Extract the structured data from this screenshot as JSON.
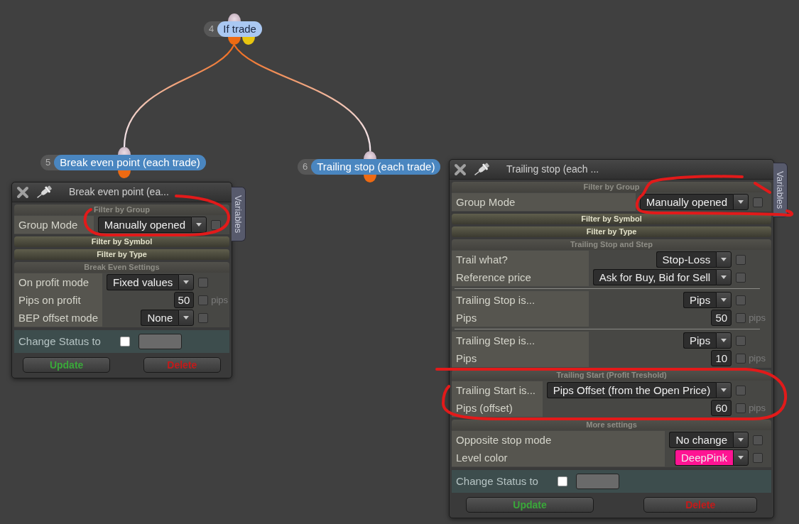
{
  "nodes": [
    {
      "number": "4",
      "title": "If trade",
      "color": "#aac8f2",
      "outputs": [
        {
          "color": "#ee6a12"
        },
        {
          "color": "#e8c510"
        }
      ],
      "children": [
        {
          "number": "5",
          "title": "Break even point (each trade)",
          "color": "#4a86c0",
          "outputs": [
            {
              "color": "#ee6a12"
            }
          ]
        },
        {
          "number": "6",
          "title": "Trailing stop (each trade)",
          "color": "#4a86c0",
          "outputs": [
            {
              "color": "#ee6a12"
            }
          ]
        }
      ]
    }
  ],
  "panels": [
    {
      "title": "Break even point (ea...",
      "side_tab": "Variables",
      "sections": [
        {
          "title": "Filter by Group",
          "expanded": true,
          "groups": [
            [
              {
                "kind": "select",
                "label": "Group Mode",
                "value": "Manually opened",
                "checked": false
              }
            ]
          ]
        },
        {
          "title": "Filter by Symbol",
          "expanded": false
        },
        {
          "title": "Filter by Type",
          "expanded": false
        },
        {
          "title": "Break Even Settings",
          "expanded": true,
          "groups": [
            [
              {
                "kind": "select",
                "label": "On profit mode",
                "value": "Fixed values",
                "checked": false
              },
              {
                "kind": "number",
                "label": "Pips on profit",
                "value": "50",
                "checked": false,
                "unit": "pips"
              },
              {
                "kind": "select",
                "label": "BEP offset mode",
                "value": "None",
                "checked": false
              }
            ]
          ]
        }
      ],
      "status": {
        "label": "Change Status to",
        "checked": false
      },
      "buttons": [
        {
          "label": "Update",
          "kind": "update"
        },
        {
          "label": "Delete",
          "kind": "delete"
        }
      ]
    },
    {
      "title": "Trailing stop (each ...",
      "side_tab": "Variables",
      "sections": [
        {
          "title": "Filter by Group",
          "expanded": true,
          "groups": [
            [
              {
                "kind": "select",
                "label": "Group Mode",
                "value": "Manually opened",
                "checked": false
              }
            ]
          ]
        },
        {
          "title": "Filter by Symbol",
          "expanded": false
        },
        {
          "title": "Filter by Type",
          "expanded": false
        },
        {
          "title": "Trailing Stop and Step",
          "expanded": true,
          "groups": [
            [
              {
                "kind": "select",
                "label": "Trail what?",
                "value": "Stop-Loss",
                "checked": false
              },
              {
                "kind": "select",
                "label": "Reference price",
                "value": "Ask for Buy, Bid for Sell",
                "checked": false
              }
            ],
            [
              {
                "kind": "select",
                "label": "Trailing Stop is...",
                "value": "Pips",
                "checked": false
              },
              {
                "kind": "number",
                "label": "Pips",
                "value": "50",
                "checked": false,
                "unit": "pips"
              }
            ],
            [
              {
                "kind": "select",
                "label": "Trailing Step is...",
                "value": "Pips",
                "checked": false
              },
              {
                "kind": "number",
                "label": "Pips",
                "value": "10",
                "checked": false,
                "unit": "pips"
              }
            ]
          ]
        },
        {
          "title": "Trailing Start (Profit Treshold)",
          "expanded": true,
          "groups": [
            [
              {
                "kind": "select",
                "label": "Trailing Start is...",
                "value": "Pips Offset (from the Open Price)",
                "checked": false
              },
              {
                "kind": "number",
                "label": "Pips (offset)",
                "value": "60",
                "checked": false,
                "unit": "pips"
              }
            ]
          ]
        },
        {
          "title": "More settings",
          "expanded": true,
          "groups": [
            [
              {
                "kind": "select",
                "label": "Opposite stop mode",
                "value": "No change",
                "checked": false
              },
              {
                "kind": "select",
                "label": "Level color",
                "value": "DeepPink",
                "color": "#ff1493",
                "checked": false
              }
            ]
          ]
        }
      ],
      "status": {
        "label": "Change Status to",
        "checked": false
      },
      "buttons": [
        {
          "label": "Update",
          "kind": "update"
        },
        {
          "label": "Delete",
          "kind": "delete"
        }
      ]
    }
  ]
}
